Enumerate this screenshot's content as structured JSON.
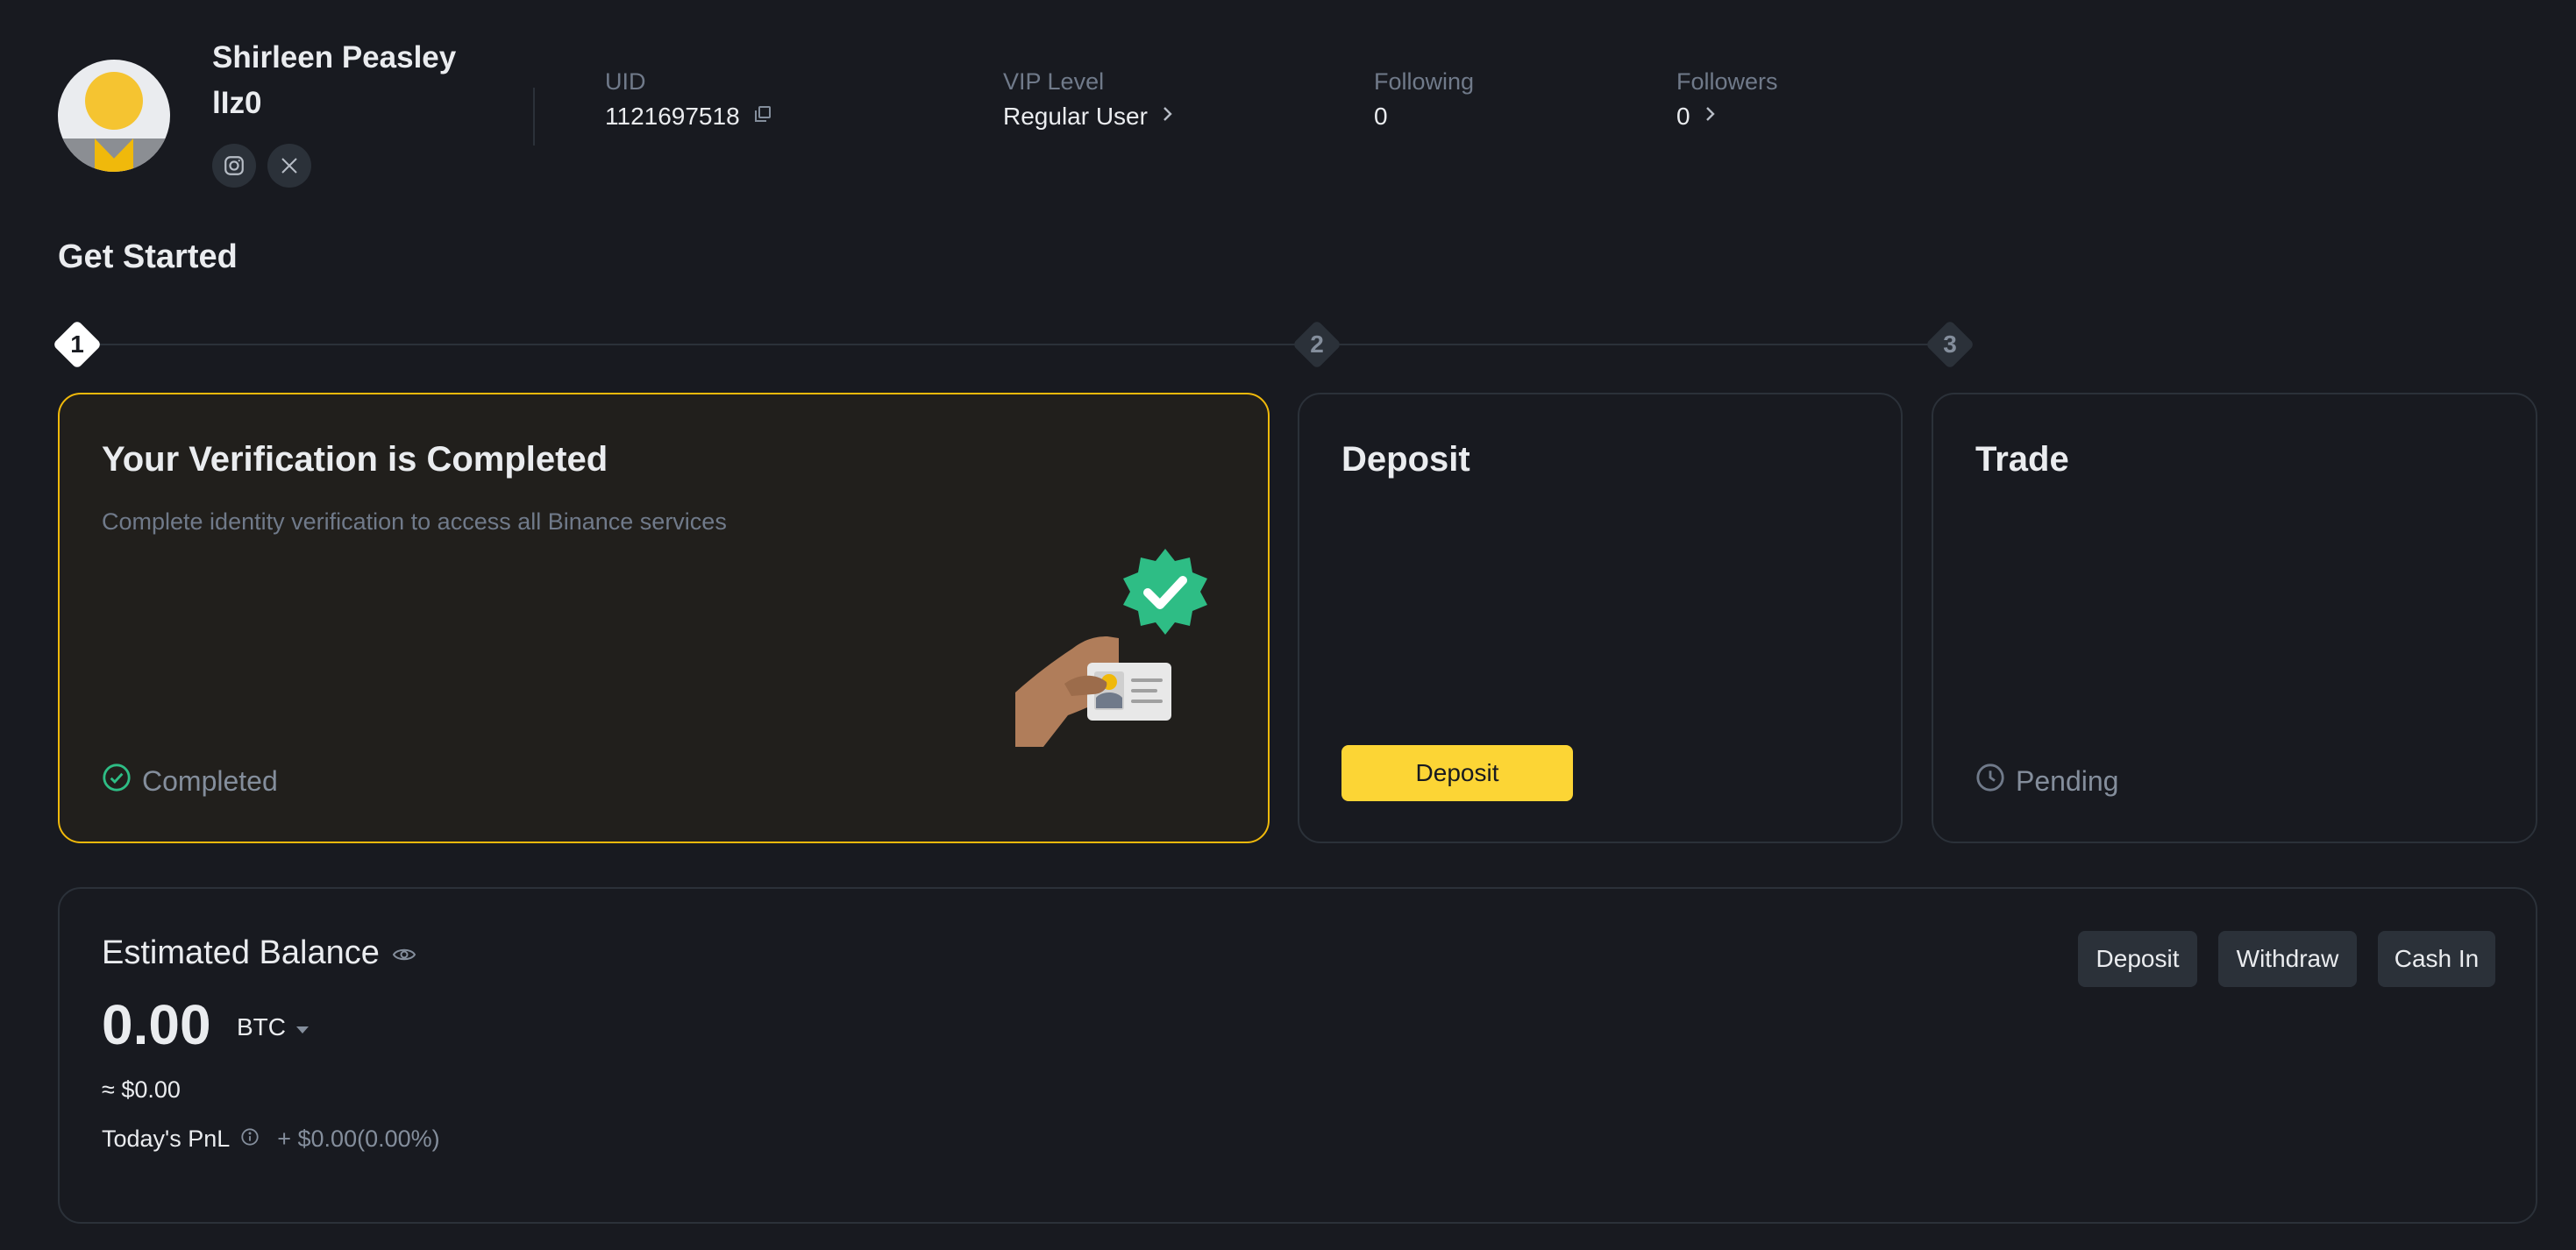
{
  "profile": {
    "username": "Shirleen Peasley lIz0",
    "social": {
      "instagram": "instagram-icon",
      "x": "x-icon"
    }
  },
  "stats": {
    "uid": {
      "label": "UID",
      "value": "1121697518"
    },
    "vip": {
      "label": "VIP Level",
      "value": "Regular User"
    },
    "following": {
      "label": "Following",
      "value": "0"
    },
    "followers": {
      "label": "Followers",
      "value": "0"
    }
  },
  "get_started": {
    "title": "Get Started",
    "steps": [
      "1",
      "2",
      "3"
    ],
    "cards": [
      {
        "title": "Your Verification is Completed",
        "description": "Complete identity verification to access all Binance services",
        "status": "Completed"
      },
      {
        "title": "Deposit",
        "button": "Deposit"
      },
      {
        "title": "Trade",
        "status": "Pending"
      }
    ]
  },
  "balance": {
    "title": "Estimated Balance",
    "amount": "0.00",
    "currency": "BTC",
    "usd": "≈ $0.00",
    "pnl_label": "Today's PnL",
    "pnl_value": "+ $0.00(0.00%)",
    "buttons": {
      "deposit": "Deposit",
      "withdraw": "Withdraw",
      "cash_in": "Cash In"
    }
  },
  "colors": {
    "background": "#181a20",
    "accent": "#fcd535",
    "success": "#0ecb81",
    "card_active_border": "#f0b90b"
  }
}
